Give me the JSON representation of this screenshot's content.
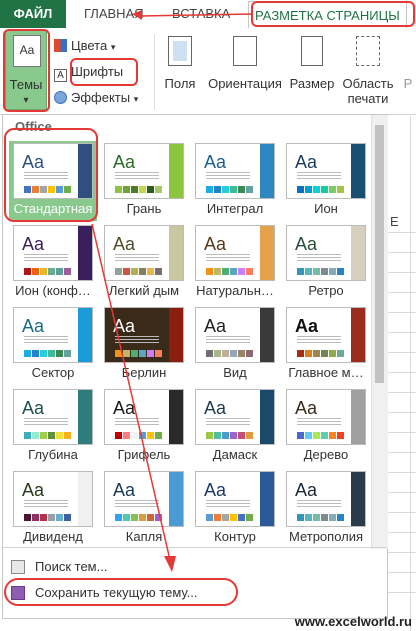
{
  "tabs": {
    "file": "ФАЙЛ",
    "home": "ГЛАВНАЯ",
    "insert": "ВСТАВКА",
    "layout": "РАЗМЕТКА СТРАНИЦЫ"
  },
  "ribbon": {
    "themes": "Темы",
    "colors": "Цвета",
    "fonts": "Шрифты",
    "effects": "Эффекты",
    "margins": "Поля",
    "orientation": "Ориентация",
    "size": "Размер",
    "print_area_1": "Область",
    "print_area_2": "печати",
    "colors_arrow": "▾",
    "effects_arrow": "▾",
    "dropdown_arrow": "▾",
    "cut": "Р",
    "font_icon_letter": "A"
  },
  "sheet": {
    "col_header": "E"
  },
  "gallery": {
    "section": "Office",
    "aa": "Aa",
    "tiles": [
      {
        "label": "Стандартная",
        "accent": "#2f4f7f",
        "side": "#2f4f7f",
        "bars": [
          "#4472c4",
          "#ed7d31",
          "#a5a5a5",
          "#ffc000",
          "#5b9bd5",
          "#70ad47"
        ],
        "selected": true
      },
      {
        "label": "Грань",
        "accent": "#2a6b2a",
        "side": "#8cc63f",
        "bars": [
          "#8cc63f",
          "#6fa03a",
          "#4a7c2a",
          "#c0d84a",
          "#2f5d1e",
          "#a6c86b"
        ]
      },
      {
        "label": "Интеграл",
        "accent": "#1e5e8c",
        "side": "#2e86c1",
        "bars": [
          "#1cade4",
          "#2683c6",
          "#27ced7",
          "#42ba97",
          "#3e8853",
          "#62a39f"
        ]
      },
      {
        "label": "Ион",
        "accent": "#1b3d5c",
        "side": "#1b4f72",
        "bars": [
          "#0f6fc6",
          "#009dd9",
          "#0bd0d9",
          "#10cf9b",
          "#7cca62",
          "#a5c249"
        ]
      },
      {
        "label": "Ион (конф…",
        "accent": "#3b1f5c",
        "side": "#3b1f5c",
        "bars": [
          "#b01513",
          "#ea6312",
          "#e6b729",
          "#6aac90",
          "#5f9c9d",
          "#9e5e9b"
        ]
      },
      {
        "label": "Легкий дым",
        "accent": "#4d4d2a",
        "side": "#c8c8a0",
        "bars": [
          "#93a299",
          "#cf543f",
          "#b5ae53",
          "#848058",
          "#e8b54d",
          "#786c71"
        ]
      },
      {
        "label": "Натуральн…",
        "accent": "#5a3a1a",
        "side": "#e6a24a",
        "bars": [
          "#f09415",
          "#c1b56b",
          "#4baf73",
          "#5aa6c0",
          "#d17df9",
          "#fa7e5c"
        ]
      },
      {
        "label": "Ретро",
        "accent": "#2a4d3a",
        "side": "#d9cfc0",
        "bars": [
          "#3494ba",
          "#58b6c0",
          "#75bda7",
          "#7a8c8e",
          "#84acb6",
          "#2683c6"
        ]
      },
      {
        "label": "Сектор",
        "accent": "#1a6a8a",
        "side": "#1a9ad6",
        "bars": [
          "#1cade4",
          "#2683c6",
          "#27ced7",
          "#42ba97",
          "#3e8853",
          "#62a39f"
        ]
      },
      {
        "label": "Берлин",
        "accent": "#fff",
        "side": "#8b1e0e",
        "bars": [
          "#f09415",
          "#c1b56b",
          "#4baf73",
          "#5aa6c0",
          "#d17df9",
          "#fa7e5c"
        ],
        "dark": true
      },
      {
        "label": "Вид",
        "accent": "#222",
        "side": "#3a3a3a",
        "bars": [
          "#6f6f74",
          "#a7b789",
          "#beae98",
          "#92a9b9",
          "#9c8265",
          "#8d6974"
        ]
      },
      {
        "label": "Главное м…",
        "accent": "#111",
        "side": "#9b2d1f",
        "bars": [
          "#a53010",
          "#de7e18",
          "#9f8351",
          "#728653",
          "#92aa4c",
          "#6aac91"
        ],
        "bold": true
      },
      {
        "label": "Глубина",
        "accent": "#1f4f4f",
        "side": "#2e7d7d",
        "bars": [
          "#41aebd",
          "#97e9d5",
          "#a2cf49",
          "#608f3d",
          "#f4de3a",
          "#fcb11c"
        ]
      },
      {
        "label": "Грифель",
        "accent": "#1a1a1a",
        "side": "#2a2a2a",
        "bars": [
          "#c00000",
          "#ff7c80",
          "#f2f2f2",
          "#5b9bd5",
          "#ffc000",
          "#70ad47"
        ]
      },
      {
        "label": "Дамаск",
        "accent": "#1f3a4f",
        "side": "#1a4a6a",
        "bars": [
          "#9ec544",
          "#50bea3",
          "#4a9ccc",
          "#9a66ca",
          "#c54f71",
          "#de9c3c"
        ]
      },
      {
        "label": "Дерево",
        "accent": "#3a2a1a",
        "side": "#a0a0a0",
        "bars": [
          "#4e67c8",
          "#5eccf3",
          "#a7ea52",
          "#5dceaf",
          "#ff8021",
          "#f14124"
        ]
      },
      {
        "label": "Дивиденд",
        "accent": "#2a3a1a",
        "side": "#f0f0f0",
        "bars": [
          "#4d1434",
          "#903163",
          "#b2324b",
          "#969fa7",
          "#66b1ce",
          "#40619d"
        ]
      },
      {
        "label": "Капля",
        "accent": "#1a3a5a",
        "side": "#4a9ad6",
        "bars": [
          "#2fa3ee",
          "#4bcaad",
          "#86c157",
          "#d99c3f",
          "#ce6633",
          "#a35dd1"
        ]
      },
      {
        "label": "Контур",
        "accent": "#1a3a6a",
        "side": "#2a5a9a",
        "bars": [
          "#5b9bd5",
          "#ed7d31",
          "#a5a5a5",
          "#ffc000",
          "#4472c4",
          "#70ad47"
        ]
      },
      {
        "label": "Метрополия",
        "accent": "#1a2a3a",
        "side": "#2a3a4a",
        "bars": [
          "#3494ba",
          "#58b6c0",
          "#75bda7",
          "#7a8c8e",
          "#84acb6",
          "#2683c6"
        ]
      }
    ]
  },
  "menu": {
    "browse": "Поиск тем...",
    "save": "Сохранить текущую тему..."
  },
  "watermark": "www.excelworld.ru"
}
